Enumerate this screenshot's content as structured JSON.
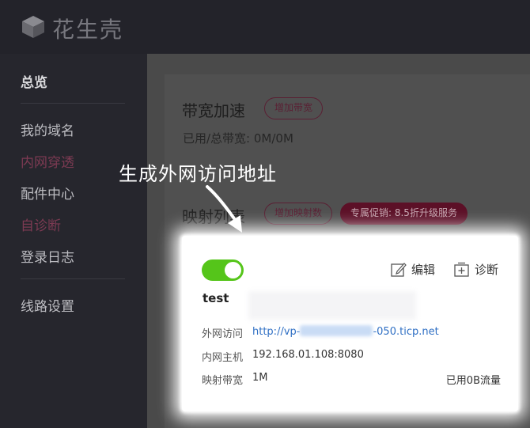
{
  "header": {
    "logo_text": "花生壳"
  },
  "sidebar": {
    "items": [
      {
        "label": "总览"
      },
      {
        "label": "我的域名"
      },
      {
        "label": "内网穿透"
      },
      {
        "label": "配件中心"
      },
      {
        "label": "自诊断"
      },
      {
        "label": "登录日志"
      },
      {
        "label": "线路设置"
      }
    ]
  },
  "bandwidth": {
    "title": "带宽加速",
    "add_label": "增加带宽",
    "usage_label": "已用/总带宽:",
    "usage_value": "0M/0M"
  },
  "mapping": {
    "title": "映射列表",
    "add_label": "增加映射数",
    "promo_label": "专属促销: 8.5折升级服务"
  },
  "callout": {
    "text": "生成外网访问地址"
  },
  "card": {
    "enabled": true,
    "name": "test",
    "edit_label": "编辑",
    "diagnose_label": "诊断",
    "external_label": "外网访问",
    "external_prefix": "http://vp-",
    "external_suffix": "-050.ticp.net",
    "internal_label": "内网主机",
    "internal_value": "192.168.01.108:8080",
    "bandwidth_label": "映射带宽",
    "bandwidth_value": "1M",
    "traffic_value": "已用0B流量"
  },
  "colors": {
    "accent_pink": "#7c3a52",
    "toggle_green": "#55c51a",
    "link_blue": "#2f6fc4"
  }
}
